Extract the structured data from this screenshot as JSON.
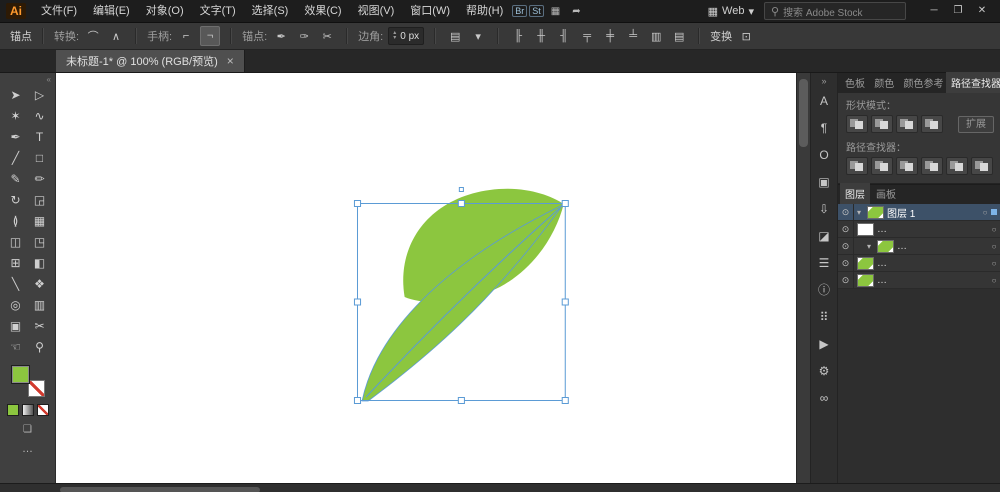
{
  "app": {
    "logo_text": "Ai",
    "window_controls": [
      {
        "name": "minimize",
        "glyph": "─"
      },
      {
        "name": "maximize",
        "glyph": "❐"
      },
      {
        "name": "close",
        "glyph": "✕"
      }
    ]
  },
  "menubar": {
    "items": [
      {
        "label": "文件(F)"
      },
      {
        "label": "编辑(E)"
      },
      {
        "label": "对象(O)"
      },
      {
        "label": "文字(T)"
      },
      {
        "label": "选择(S)"
      },
      {
        "label": "效果(C)"
      },
      {
        "label": "视图(V)"
      },
      {
        "label": "窗口(W)"
      },
      {
        "label": "帮助(H)"
      }
    ],
    "quick_icons": [
      {
        "name": "bridge-badge",
        "glyph": "Br"
      },
      {
        "name": "stock-badge",
        "glyph": "St"
      },
      {
        "name": "arrange-documents-icon",
        "glyph": "▦"
      },
      {
        "name": "share-icon",
        "glyph": "➦"
      }
    ],
    "workspace": {
      "icon": "▦",
      "label": "Web",
      "caret": "▾"
    },
    "search": {
      "icon": "⚲",
      "placeholder": "搜索 Adobe Stock"
    }
  },
  "controlbar": {
    "mode_label": "锚点",
    "convert_label": "转换:",
    "convert_buttons": [
      {
        "glyph": "⌒"
      },
      {
        "glyph": "∧"
      }
    ],
    "handles_label": "手柄:",
    "handle_buttons": [
      {
        "glyph": "⌐"
      },
      {
        "glyph": "¬"
      }
    ],
    "anchors_label": "锚点:",
    "anchor_buttons": [
      {
        "glyph": "✒"
      },
      {
        "glyph": "✑"
      },
      {
        "glyph": "✂"
      }
    ],
    "corner_label": "边角:",
    "corner_value": "0 px",
    "spin_up": "▴",
    "spin_down": "▾",
    "doc_setup_icon": "▤",
    "doc_setup_caret": "▾",
    "align_buttons": [
      {
        "glyph": "╟"
      },
      {
        "glyph": "╫"
      },
      {
        "glyph": "╢"
      },
      {
        "glyph": "╤"
      },
      {
        "glyph": "╪"
      },
      {
        "glyph": "╧"
      },
      {
        "glyph": "▥"
      },
      {
        "glyph": "▤"
      }
    ],
    "transform_label": "变换",
    "isolate_icon": "⊡"
  },
  "tabbar": {
    "tabs": [
      {
        "title": "未标题-1* @ 100% (RGB/预览)",
        "close_glyph": "×"
      }
    ]
  },
  "toolbar": {
    "collapse_glyph": "«",
    "ellipsis": "…",
    "drawmode_glyph": "❏",
    "fill_color": "#8cc63f",
    "tools": [
      {
        "name": "selection-tool",
        "glyph": "➤"
      },
      {
        "name": "direct-selection-tool",
        "glyph": "▷"
      },
      {
        "name": "magic-wand-tool",
        "glyph": "✶"
      },
      {
        "name": "lasso-tool",
        "glyph": "∿"
      },
      {
        "name": "pen-tool",
        "glyph": "✒"
      },
      {
        "name": "type-tool",
        "glyph": "T"
      },
      {
        "name": "line-segment-tool",
        "glyph": "╱"
      },
      {
        "name": "rectangle-tool",
        "glyph": "□"
      },
      {
        "name": "paintbrush-tool",
        "glyph": "✎"
      },
      {
        "name": "pencil-tool",
        "glyph": "✏"
      },
      {
        "name": "rotate-tool",
        "glyph": "↻"
      },
      {
        "name": "scale-tool",
        "glyph": "◲"
      },
      {
        "name": "width-tool",
        "glyph": "≬"
      },
      {
        "name": "free-transform-tool",
        "glyph": "▦"
      },
      {
        "name": "shape-builder-tool",
        "glyph": "◫"
      },
      {
        "name": "perspective-grid-tool",
        "glyph": "◳"
      },
      {
        "name": "mesh-tool",
        "glyph": "⊞"
      },
      {
        "name": "gradient-tool",
        "glyph": "◧"
      },
      {
        "name": "eyedropper-tool",
        "glyph": "╲"
      },
      {
        "name": "blend-tool",
        "glyph": "❖"
      },
      {
        "name": "symbol-sprayer-tool",
        "glyph": "◎"
      },
      {
        "name": "column-graph-tool",
        "glyph": "▥"
      },
      {
        "name": "artboard-tool",
        "glyph": "▣"
      },
      {
        "name": "slice-tool",
        "glyph": "✂"
      },
      {
        "name": "hand-tool",
        "glyph": "☜"
      },
      {
        "name": "zoom-tool",
        "glyph": "⚲"
      }
    ]
  },
  "canvas": {
    "leaf_color": "#8cc63f",
    "selection_color": "#5b9bd5",
    "artboard_color": "#ffffff"
  },
  "dock": {
    "collapse_glyph": "»",
    "icons": [
      {
        "name": "character-panel-icon",
        "glyph": "A"
      },
      {
        "name": "paragraph-panel-icon",
        "glyph": "¶"
      },
      {
        "name": "opentype-panel-icon",
        "glyph": "O"
      },
      {
        "name": "artboards-panel-icon",
        "glyph": "▣"
      },
      {
        "name": "asset-export-panel-icon",
        "glyph": "⇩"
      },
      {
        "name": "transform-panel-icon",
        "glyph": "◪"
      },
      {
        "name": "stroke-panel-icon",
        "glyph": "☰"
      },
      {
        "name": "info-panel-icon",
        "glyph": "ⓘ"
      },
      {
        "name": "swatches-panel-icon",
        "glyph": "⠿"
      },
      {
        "name": "actions-panel-icon",
        "glyph": "▶"
      },
      {
        "name": "graphic-styles-panel-icon",
        "glyph": "⚙"
      },
      {
        "name": "links-panel-icon",
        "glyph": "∞"
      }
    ]
  },
  "panels": {
    "group1_tabs": [
      {
        "label": "色板"
      },
      {
        "label": "颜色"
      },
      {
        "label": "颜色参考"
      },
      {
        "label": "路径查找器"
      }
    ],
    "pathfinder": {
      "shape_modes_label": "形状模式：",
      "expand_label": "扩展",
      "pathfinders_label": "路径查找器："
    },
    "layers": {
      "tabs": [
        {
          "label": "图层"
        },
        {
          "label": "画板"
        }
      ],
      "eye_glyph": "⊙",
      "caret_glyph": "▾",
      "target_glyph": "○",
      "rows": [
        {
          "label": "图层 1"
        },
        {
          "label": "…"
        },
        {
          "label": "…"
        },
        {
          "label": "…"
        },
        {
          "label": "…"
        }
      ]
    }
  }
}
